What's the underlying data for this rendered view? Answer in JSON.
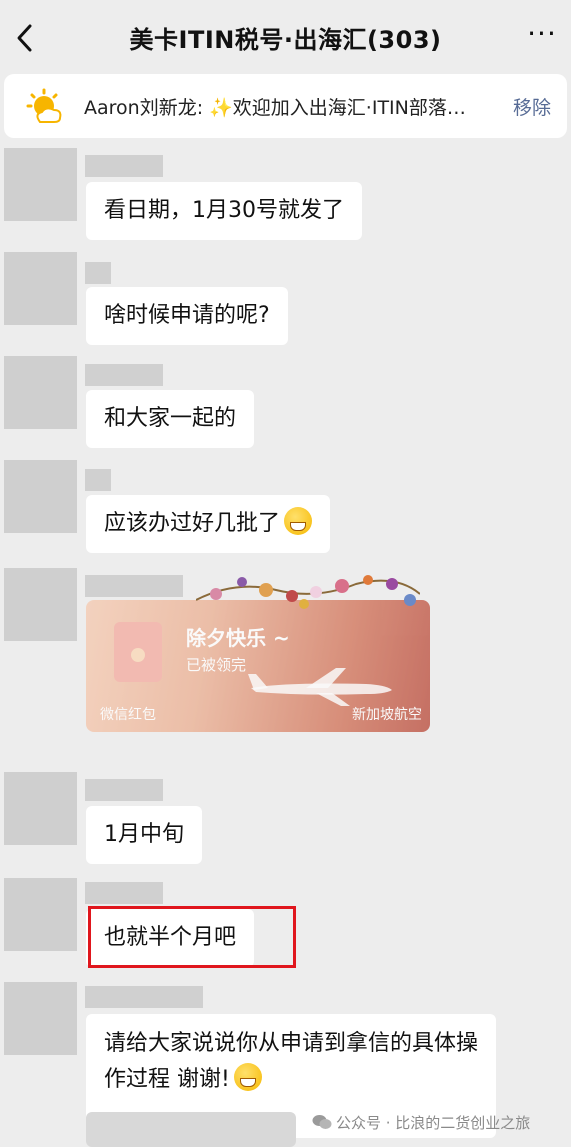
{
  "header": {
    "title": "美卡ITIN税号·出海汇(303)",
    "back_icon": "back-chevron-icon",
    "more_icon": "more-dots-icon",
    "more_label": "···"
  },
  "pinned": {
    "sender": "Aaron刘新龙",
    "message": "Aaron刘新龙: ✨欢迎加入出海汇·ITIN部落…",
    "remove_label": "移除",
    "icon": "sun-icon"
  },
  "messages": [
    {
      "text": "看日期，1月30号就发了"
    },
    {
      "text": "啥时候申请的呢?"
    },
    {
      "text": "和大家一起的"
    },
    {
      "text": "应该办过好几批了"
    },
    {
      "text": "1月中旬"
    },
    {
      "text": "也就半个月吧"
    },
    {
      "text": "请给大家说说你从申请到拿信的具体操作过程 谢谢!"
    }
  ],
  "red_packet": {
    "title": "除夕快乐 ~",
    "status": "已被领完",
    "label": "微信红包",
    "brand": "新加坡航空"
  },
  "watermark": "公众号 · 比浪的二货创业之旅",
  "colors": {
    "background": "#ededed",
    "link": "#576b95",
    "highlight": "#e0161d"
  }
}
